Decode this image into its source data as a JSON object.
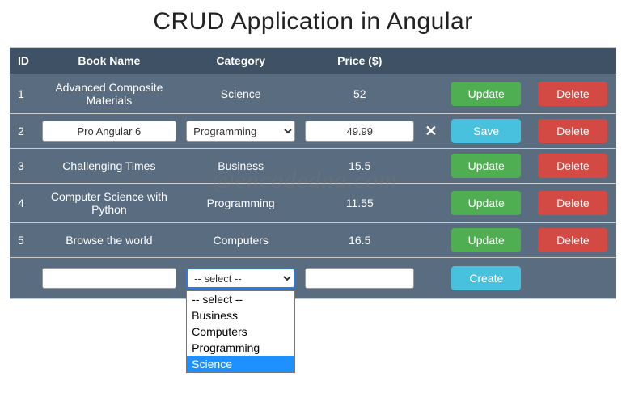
{
  "title": "CRUD Application in Angular",
  "watermark": "@encodedna.com",
  "headers": {
    "id": "ID",
    "name": "Book Name",
    "category": "Category",
    "price": "Price ($)"
  },
  "rows": [
    {
      "id": "1",
      "name": "Advanced Composite Materials",
      "category": "Science",
      "price": "52"
    },
    {
      "id": "3",
      "name": "Challenging Times",
      "category": "Business",
      "price": "15.5"
    },
    {
      "id": "4",
      "name": "Computer Science with Python",
      "category": "Programming",
      "price": "11.55"
    },
    {
      "id": "5",
      "name": "Browse the world",
      "category": "Computers",
      "price": "16.5"
    }
  ],
  "editRow": {
    "id": "2",
    "name": "Pro Angular 6",
    "category": "Programming",
    "price": "49.99"
  },
  "newRow": {
    "name": "",
    "category_display": "-- select --",
    "price": ""
  },
  "dropdown": {
    "options": [
      "-- select --",
      "Business",
      "Computers",
      "Programming",
      "Science"
    ],
    "highlighted": "Science"
  },
  "buttons": {
    "update": "Update",
    "delete": "Delete",
    "save": "Save",
    "create": "Create",
    "cancel_glyph": "✕"
  }
}
